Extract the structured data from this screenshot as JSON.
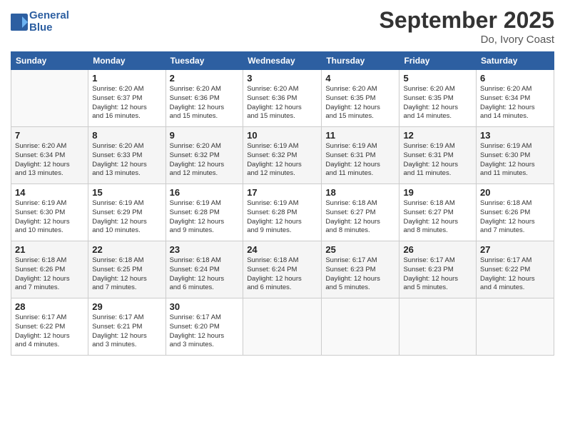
{
  "header": {
    "logo_line1": "General",
    "logo_line2": "Blue",
    "month": "September 2025",
    "location": "Do, Ivory Coast"
  },
  "days_of_week": [
    "Sunday",
    "Monday",
    "Tuesday",
    "Wednesday",
    "Thursday",
    "Friday",
    "Saturday"
  ],
  "weeks": [
    [
      {
        "day": "",
        "sunrise": "",
        "sunset": "",
        "daylight": "",
        "empty": true
      },
      {
        "day": "1",
        "sunrise": "Sunrise: 6:20 AM",
        "sunset": "Sunset: 6:37 PM",
        "daylight": "Daylight: 12 hours and 16 minutes."
      },
      {
        "day": "2",
        "sunrise": "Sunrise: 6:20 AM",
        "sunset": "Sunset: 6:36 PM",
        "daylight": "Daylight: 12 hours and 15 minutes."
      },
      {
        "day": "3",
        "sunrise": "Sunrise: 6:20 AM",
        "sunset": "Sunset: 6:36 PM",
        "daylight": "Daylight: 12 hours and 15 minutes."
      },
      {
        "day": "4",
        "sunrise": "Sunrise: 6:20 AM",
        "sunset": "Sunset: 6:35 PM",
        "daylight": "Daylight: 12 hours and 15 minutes."
      },
      {
        "day": "5",
        "sunrise": "Sunrise: 6:20 AM",
        "sunset": "Sunset: 6:35 PM",
        "daylight": "Daylight: 12 hours and 14 minutes."
      },
      {
        "day": "6",
        "sunrise": "Sunrise: 6:20 AM",
        "sunset": "Sunset: 6:34 PM",
        "daylight": "Daylight: 12 hours and 14 minutes."
      }
    ],
    [
      {
        "day": "7",
        "sunrise": "Sunrise: 6:20 AM",
        "sunset": "Sunset: 6:34 PM",
        "daylight": "Daylight: 12 hours and 13 minutes."
      },
      {
        "day": "8",
        "sunrise": "Sunrise: 6:20 AM",
        "sunset": "Sunset: 6:33 PM",
        "daylight": "Daylight: 12 hours and 13 minutes."
      },
      {
        "day": "9",
        "sunrise": "Sunrise: 6:20 AM",
        "sunset": "Sunset: 6:32 PM",
        "daylight": "Daylight: 12 hours and 12 minutes."
      },
      {
        "day": "10",
        "sunrise": "Sunrise: 6:19 AM",
        "sunset": "Sunset: 6:32 PM",
        "daylight": "Daylight: 12 hours and 12 minutes."
      },
      {
        "day": "11",
        "sunrise": "Sunrise: 6:19 AM",
        "sunset": "Sunset: 6:31 PM",
        "daylight": "Daylight: 12 hours and 11 minutes."
      },
      {
        "day": "12",
        "sunrise": "Sunrise: 6:19 AM",
        "sunset": "Sunset: 6:31 PM",
        "daylight": "Daylight: 12 hours and 11 minutes."
      },
      {
        "day": "13",
        "sunrise": "Sunrise: 6:19 AM",
        "sunset": "Sunset: 6:30 PM",
        "daylight": "Daylight: 12 hours and 11 minutes."
      }
    ],
    [
      {
        "day": "14",
        "sunrise": "Sunrise: 6:19 AM",
        "sunset": "Sunset: 6:30 PM",
        "daylight": "Daylight: 12 hours and 10 minutes."
      },
      {
        "day": "15",
        "sunrise": "Sunrise: 6:19 AM",
        "sunset": "Sunset: 6:29 PM",
        "daylight": "Daylight: 12 hours and 10 minutes."
      },
      {
        "day": "16",
        "sunrise": "Sunrise: 6:19 AM",
        "sunset": "Sunset: 6:28 PM",
        "daylight": "Daylight: 12 hours and 9 minutes."
      },
      {
        "day": "17",
        "sunrise": "Sunrise: 6:19 AM",
        "sunset": "Sunset: 6:28 PM",
        "daylight": "Daylight: 12 hours and 9 minutes."
      },
      {
        "day": "18",
        "sunrise": "Sunrise: 6:18 AM",
        "sunset": "Sunset: 6:27 PM",
        "daylight": "Daylight: 12 hours and 8 minutes."
      },
      {
        "day": "19",
        "sunrise": "Sunrise: 6:18 AM",
        "sunset": "Sunset: 6:27 PM",
        "daylight": "Daylight: 12 hours and 8 minutes."
      },
      {
        "day": "20",
        "sunrise": "Sunrise: 6:18 AM",
        "sunset": "Sunset: 6:26 PM",
        "daylight": "Daylight: 12 hours and 7 minutes."
      }
    ],
    [
      {
        "day": "21",
        "sunrise": "Sunrise: 6:18 AM",
        "sunset": "Sunset: 6:26 PM",
        "daylight": "Daylight: 12 hours and 7 minutes."
      },
      {
        "day": "22",
        "sunrise": "Sunrise: 6:18 AM",
        "sunset": "Sunset: 6:25 PM",
        "daylight": "Daylight: 12 hours and 7 minutes."
      },
      {
        "day": "23",
        "sunrise": "Sunrise: 6:18 AM",
        "sunset": "Sunset: 6:24 PM",
        "daylight": "Daylight: 12 hours and 6 minutes."
      },
      {
        "day": "24",
        "sunrise": "Sunrise: 6:18 AM",
        "sunset": "Sunset: 6:24 PM",
        "daylight": "Daylight: 12 hours and 6 minutes."
      },
      {
        "day": "25",
        "sunrise": "Sunrise: 6:17 AM",
        "sunset": "Sunset: 6:23 PM",
        "daylight": "Daylight: 12 hours and 5 minutes."
      },
      {
        "day": "26",
        "sunrise": "Sunrise: 6:17 AM",
        "sunset": "Sunset: 6:23 PM",
        "daylight": "Daylight: 12 hours and 5 minutes."
      },
      {
        "day": "27",
        "sunrise": "Sunrise: 6:17 AM",
        "sunset": "Sunset: 6:22 PM",
        "daylight": "Daylight: 12 hours and 4 minutes."
      }
    ],
    [
      {
        "day": "28",
        "sunrise": "Sunrise: 6:17 AM",
        "sunset": "Sunset: 6:22 PM",
        "daylight": "Daylight: 12 hours and 4 minutes."
      },
      {
        "day": "29",
        "sunrise": "Sunrise: 6:17 AM",
        "sunset": "Sunset: 6:21 PM",
        "daylight": "Daylight: 12 hours and 3 minutes."
      },
      {
        "day": "30",
        "sunrise": "Sunrise: 6:17 AM",
        "sunset": "Sunset: 6:20 PM",
        "daylight": "Daylight: 12 hours and 3 minutes."
      },
      {
        "day": "",
        "sunrise": "",
        "sunset": "",
        "daylight": "",
        "empty": true
      },
      {
        "day": "",
        "sunrise": "",
        "sunset": "",
        "daylight": "",
        "empty": true
      },
      {
        "day": "",
        "sunrise": "",
        "sunset": "",
        "daylight": "",
        "empty": true
      },
      {
        "day": "",
        "sunrise": "",
        "sunset": "",
        "daylight": "",
        "empty": true
      }
    ]
  ]
}
